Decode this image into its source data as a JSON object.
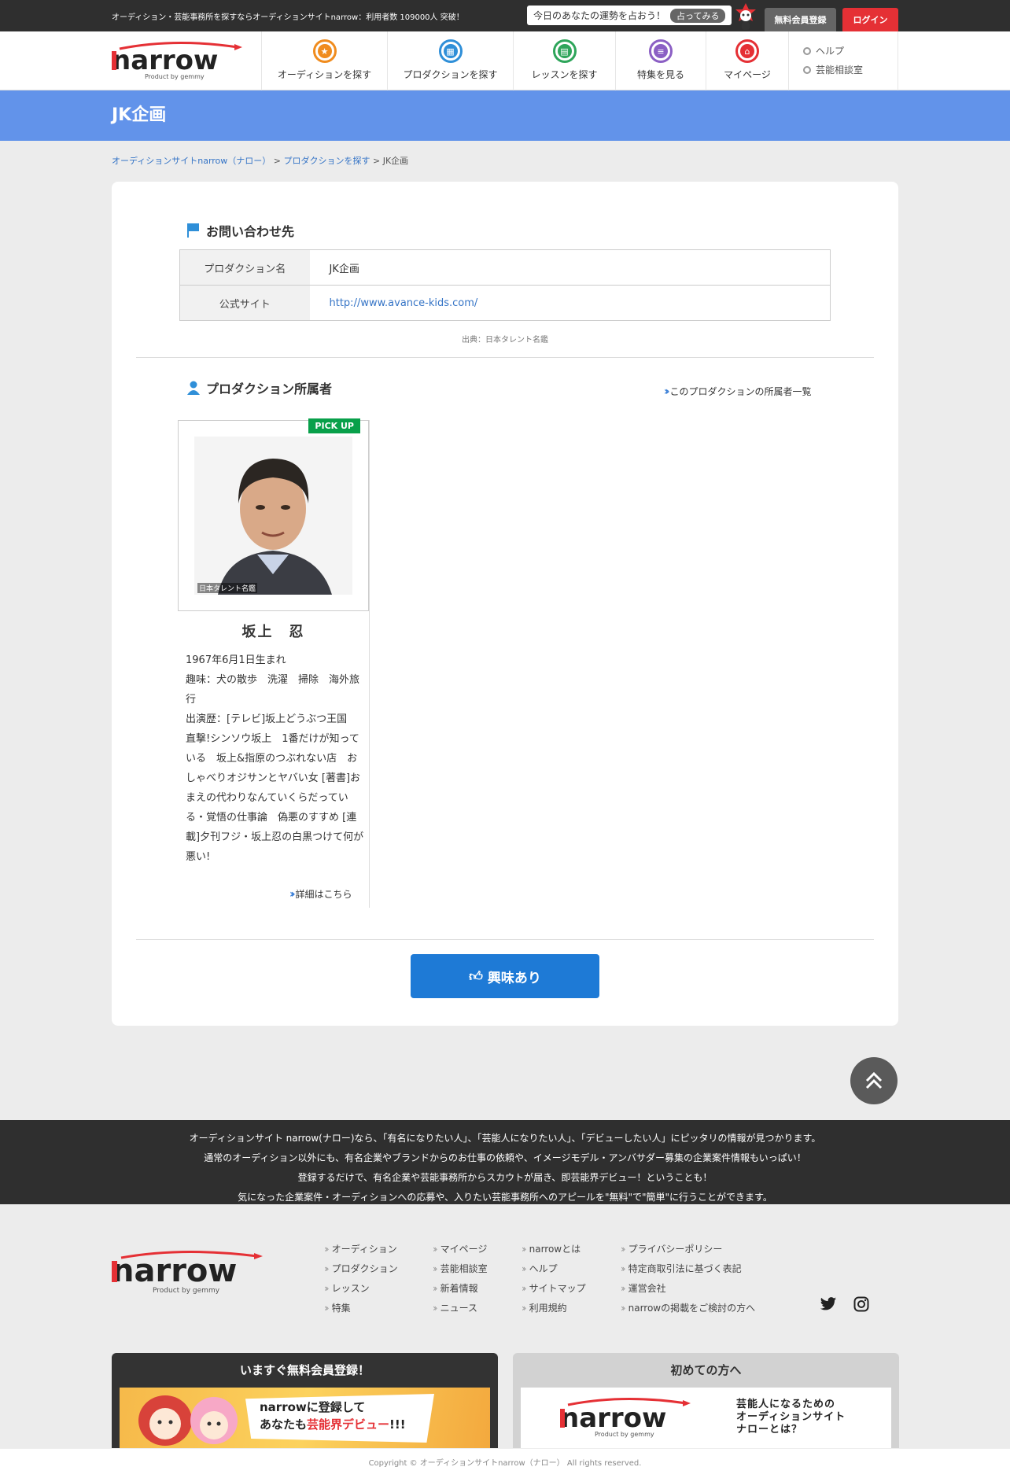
{
  "topbar": {
    "message": "オーディション・芸能事務所を探すならオーディションサイトnarrow：利用者数 109000人 突破！",
    "fortune_text": "今日のあなたの運勢を占おう！",
    "fortune_button": "占ってみる",
    "register": "無料会員登録",
    "login": "ログイン"
  },
  "logo": {
    "text": "narrow",
    "sub": "Product by gemmy"
  },
  "nav": [
    {
      "label": "オーディションを探す",
      "icon": "star-icon",
      "color": "#f08c1e"
    },
    {
      "label": "プロダクションを探す",
      "icon": "building-icon",
      "color": "#2f8fd8"
    },
    {
      "label": "レッスンを探す",
      "icon": "lesson-icon",
      "color": "#2ea55a"
    },
    {
      "label": "特集を見る",
      "icon": "feature-icon",
      "color": "#8b5fc4"
    },
    {
      "label": "マイページ",
      "icon": "home-icon",
      "color": "#e53035"
    }
  ],
  "side_links": [
    "ヘルプ",
    "芸能相談室"
  ],
  "page_title": "JK企画",
  "breadcrumb": {
    "home": "オーディションサイトnarrow（ナロー）",
    "sep1": ">",
    "productions": "プロダクションを探す",
    "sep2": ">",
    "current": "JK企画"
  },
  "contact": {
    "title": "お問い合わせ先",
    "rows": [
      {
        "label": "プロダクション名",
        "value": "JK企画"
      },
      {
        "label": "公式サイト",
        "value": "http://www.avance-kids.com/"
      }
    ],
    "source": "出典：日本タレント名鑑"
  },
  "members": {
    "title": "プロダクション所属者",
    "list_link": "このプロダクションの所属者一覧",
    "items": [
      {
        "badge": "PICK UP",
        "photo_credit": "日本タレント名鑑",
        "name": "坂上　忍",
        "bio": "1967年6月1日生まれ\n趣味：犬の散歩　洗濯　掃除　海外旅行\n出演歴：[テレビ]坂上どうぶつ王国　直撃!シンソウ坂上　1番だけが知っている　坂上&指原のつぶれない店　おしゃべりオジサンとヤバい女 [著書]おまえの代わりなんていくらだっている・覚悟の仕事論　偽悪のすすめ [連載]夕刊フジ・坂上忍の白黒つけて何が悪い!",
        "detail": "詳細はこちら"
      }
    ]
  },
  "interest_button": "興味あり",
  "footer_band": [
    "オーディションサイト narrow(ナロー)なら、「有名になりたい人」、「芸能人になりたい人」、「デビューしたい人」にピッタリの情報が見つかります。",
    "通常のオーディション以外にも、有名企業やブランドからのお仕事の依頼や、イメージモデル・アンバサダー募集の企業案件情報もいっぱい！",
    "登録するだけで、有名企業や芸能事務所からスカウトが届き、即芸能界デビュー！ということも！",
    "気になった企業案件・オーディションへの応募や、入りたい芸能事務所へのアピールを\"無料\"で\"簡単\"に行うことができます。"
  ],
  "footer_links": [
    [
      "オーディション",
      "プロダクション",
      "レッスン",
      "特集"
    ],
    [
      "マイページ",
      "芸能相談室",
      "新着情報",
      "ニュース"
    ],
    [
      "narrowとは",
      "ヘルプ",
      "サイトマップ",
      "利用規約"
    ],
    [
      "プライバシーポリシー",
      "特定商取引法に基づく表記",
      "運営会社",
      "narrowの掲載をご検討の方へ"
    ]
  ],
  "promo_left": {
    "title": "いますぐ無料会員登録！",
    "line1": "narrowに登録して",
    "line2a": "あなたも",
    "line2b": "芸能界デビュー",
    "line2c": "!!!"
  },
  "promo_right": {
    "title": "初めての方へ",
    "text1": "芸能人になるための",
    "text2": "オーディションサイト",
    "text3": "ナローとは？"
  },
  "copyright": "Copyright © オーディションサイトnarrow（ナロー） All rights reserved."
}
